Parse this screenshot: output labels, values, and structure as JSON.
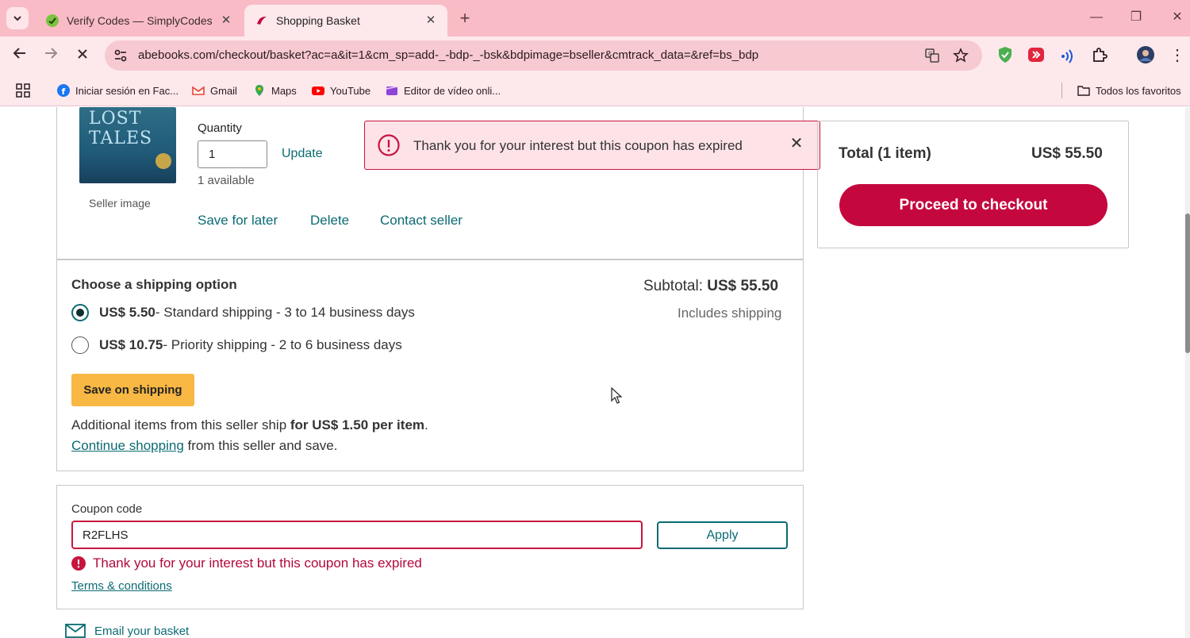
{
  "browser": {
    "tabs": [
      {
        "title": "Verify Codes — SimplyCodes",
        "active": false
      },
      {
        "title": "Shopping Basket",
        "active": true
      }
    ],
    "url": "abebooks.com/checkout/basket?ac=a&it=1&cm_sp=add-_-bdp-_-bsk&bdpimage=bseller&cmtrack_data=&ref=bs_bdp",
    "bookmarks": [
      {
        "label": "Iniciar sesión en Fac...",
        "icon": "facebook-icon"
      },
      {
        "label": "Gmail",
        "icon": "gmail-icon"
      },
      {
        "label": "Maps",
        "icon": "maps-icon"
      },
      {
        "label": "YouTube",
        "icon": "youtube-icon"
      },
      {
        "label": "Editor de vídeo onli...",
        "icon": "video-editor-icon"
      }
    ],
    "all_bookmarks": "Todos los favoritos"
  },
  "item": {
    "book_title_art": "LOST TALES",
    "seller_image_label": "Seller image",
    "quantity_label": "Quantity",
    "quantity_value": "1",
    "update_label": "Update",
    "available": "1 available",
    "actions": [
      "Save for later",
      "Delete",
      "Contact seller"
    ]
  },
  "toast": {
    "message": "Thank you for your interest but this coupon has expired"
  },
  "summary": {
    "total_label": "Total (1 item)",
    "total_value": "US$ 55.50",
    "checkout_label": "Proceed to checkout"
  },
  "shipping": {
    "title": "Choose a shipping option",
    "subtotal_label": "Subtotal:",
    "subtotal_value": "US$ 55.50",
    "includes_shipping": "Includes shipping",
    "options": [
      {
        "price": "US$ 5.50",
        "desc": " - Standard shipping - 3 to 14 business days",
        "selected": true
      },
      {
        "price": "US$ 10.75",
        "desc": " - Priority shipping - 2 to 6 business days",
        "selected": false
      }
    ],
    "save_button": "Save on shipping",
    "additional_prefix": "Additional items from this seller ship ",
    "additional_bold": "for US$ 1.50 per item",
    "additional_suffix": ".",
    "continue_link": "Continue shopping",
    "continue_suffix": " from this seller and save."
  },
  "coupon": {
    "label": "Coupon code",
    "value": "R2FLHS",
    "apply_label": "Apply",
    "error": "Thank you for your interest but this coupon has expired",
    "terms": "Terms & conditions"
  },
  "email_basket": "Email your basket",
  "colors": {
    "tabbar": "#f9bcc6",
    "toolbar": "#fde8ec",
    "accent_teal": "#0b6b73",
    "checkout_red": "#c4083e",
    "error_red": "#c6163f",
    "save_button": "#f8b843"
  }
}
